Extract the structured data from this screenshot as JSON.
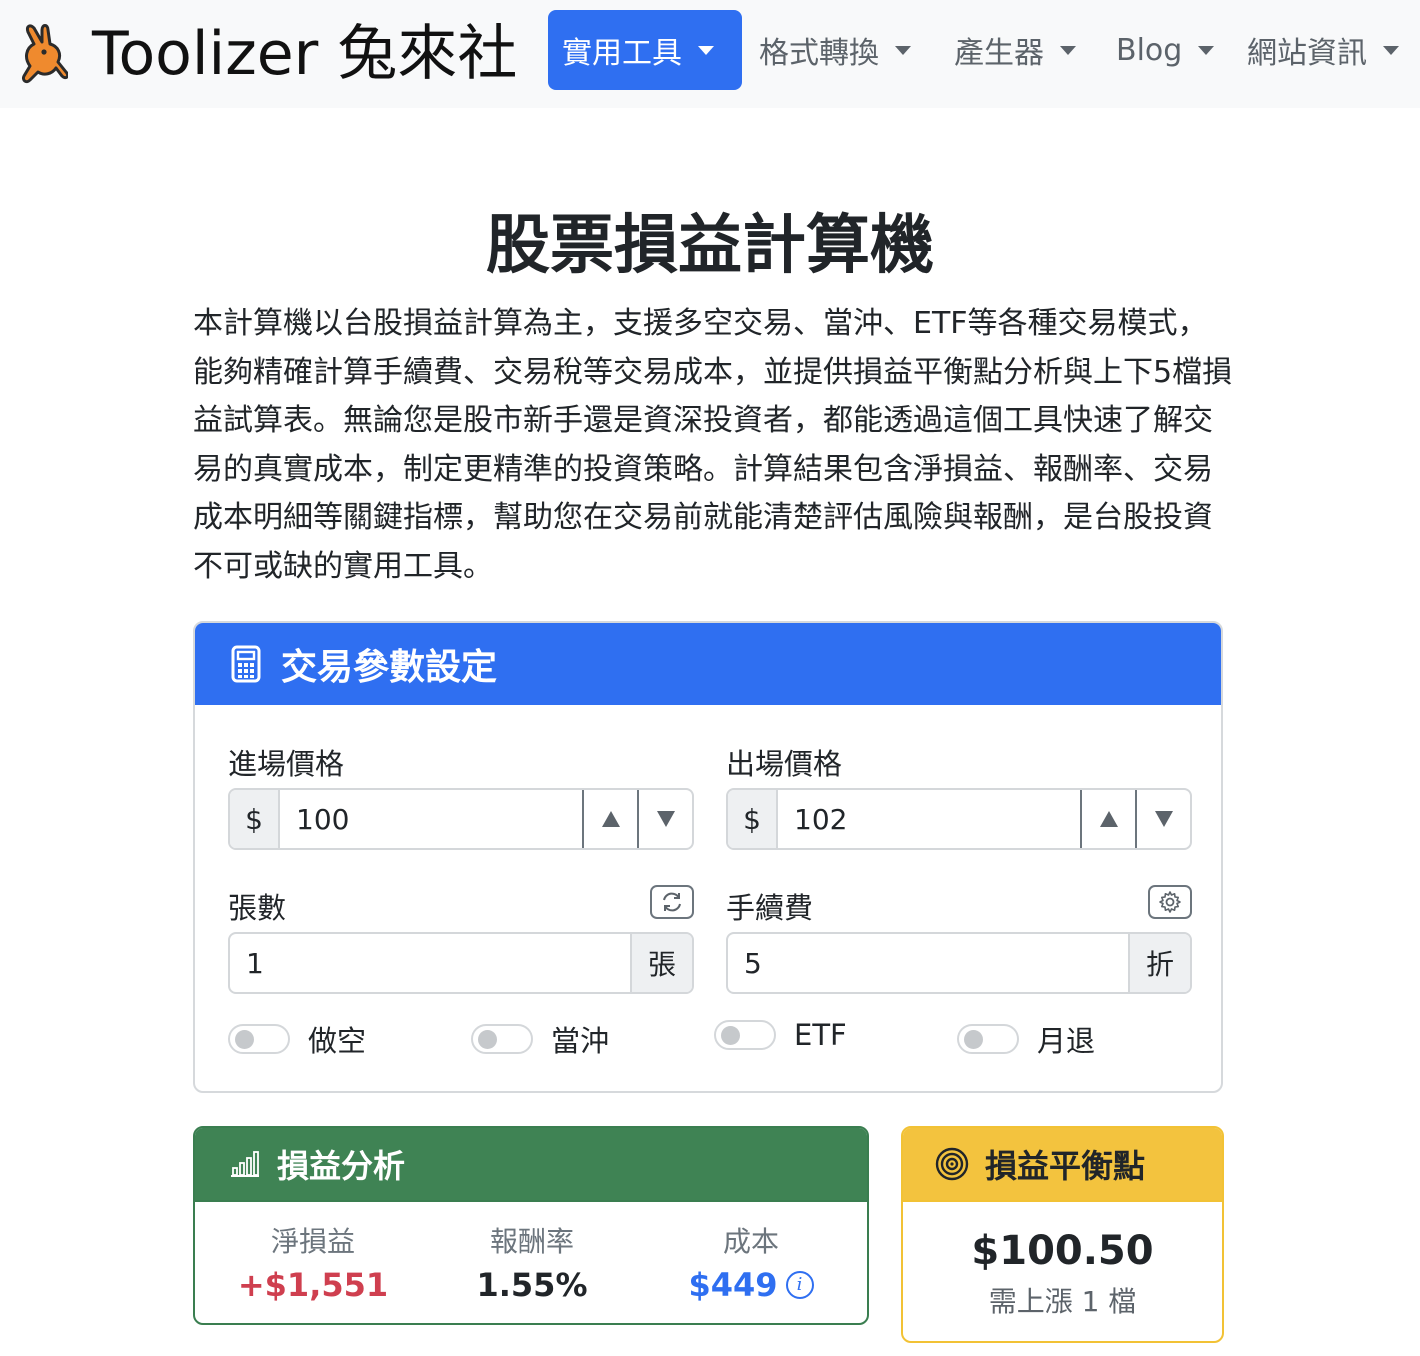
{
  "navbar": {
    "brand": "Toolizer 兔來社",
    "items": [
      {
        "label": "實用工具",
        "active": true
      },
      {
        "label": "格式轉換"
      },
      {
        "label": "產生器"
      },
      {
        "label": "Blog"
      },
      {
        "label": "網站資訊"
      }
    ]
  },
  "page": {
    "title": "股票損益計算機",
    "intro": "本計算機以台股損益計算為主，支援多空交易、當沖、ETF等各種交易模式，能夠精確計算手續費、交易稅等交易成本，並提供損益平衡點分析與上下5檔損益試算表。無論您是股市新手還是資深投資者，都能透過這個工具快速了解交易的真實成本，制定更精準的投資策略。計算結果包含淨損益、報酬率、交易成本明細等關鍵指標，幫助您在交易前就能清楚評估風險與報酬，是台股投資不可或缺的實用工具。"
  },
  "params": {
    "header": "交易參數設定",
    "entry": {
      "label": "進場價格",
      "prefix": "$",
      "value": "100"
    },
    "exit": {
      "label": "出場價格",
      "prefix": "$",
      "value": "102"
    },
    "lots": {
      "label": "張數",
      "value": "1",
      "suffix": "張"
    },
    "fee": {
      "label": "手續費",
      "value": "5",
      "suffix": "折"
    },
    "toggles": [
      {
        "label": "做空",
        "on": false
      },
      {
        "label": "當沖",
        "on": false
      },
      {
        "label": "ETF",
        "on": false
      },
      {
        "label": "月退",
        "on": false
      }
    ]
  },
  "analysis": {
    "header": "損益分析",
    "net": {
      "label": "淨損益",
      "value": "+$1,551",
      "color": "#cf3f4f"
    },
    "roi": {
      "label": "報酬率",
      "value": "1.55%",
      "color": "#212529"
    },
    "cost": {
      "label": "成本",
      "value": "$449",
      "color": "#2f6ff1"
    }
  },
  "breakeven": {
    "header": "損益平衡點",
    "price": "$100.50",
    "note": "需上漲 1 檔"
  },
  "colors": {
    "primary": "#2f6ff1",
    "success": "#3f8354",
    "warning": "#f3c33e",
    "danger": "#cf3f4f"
  }
}
